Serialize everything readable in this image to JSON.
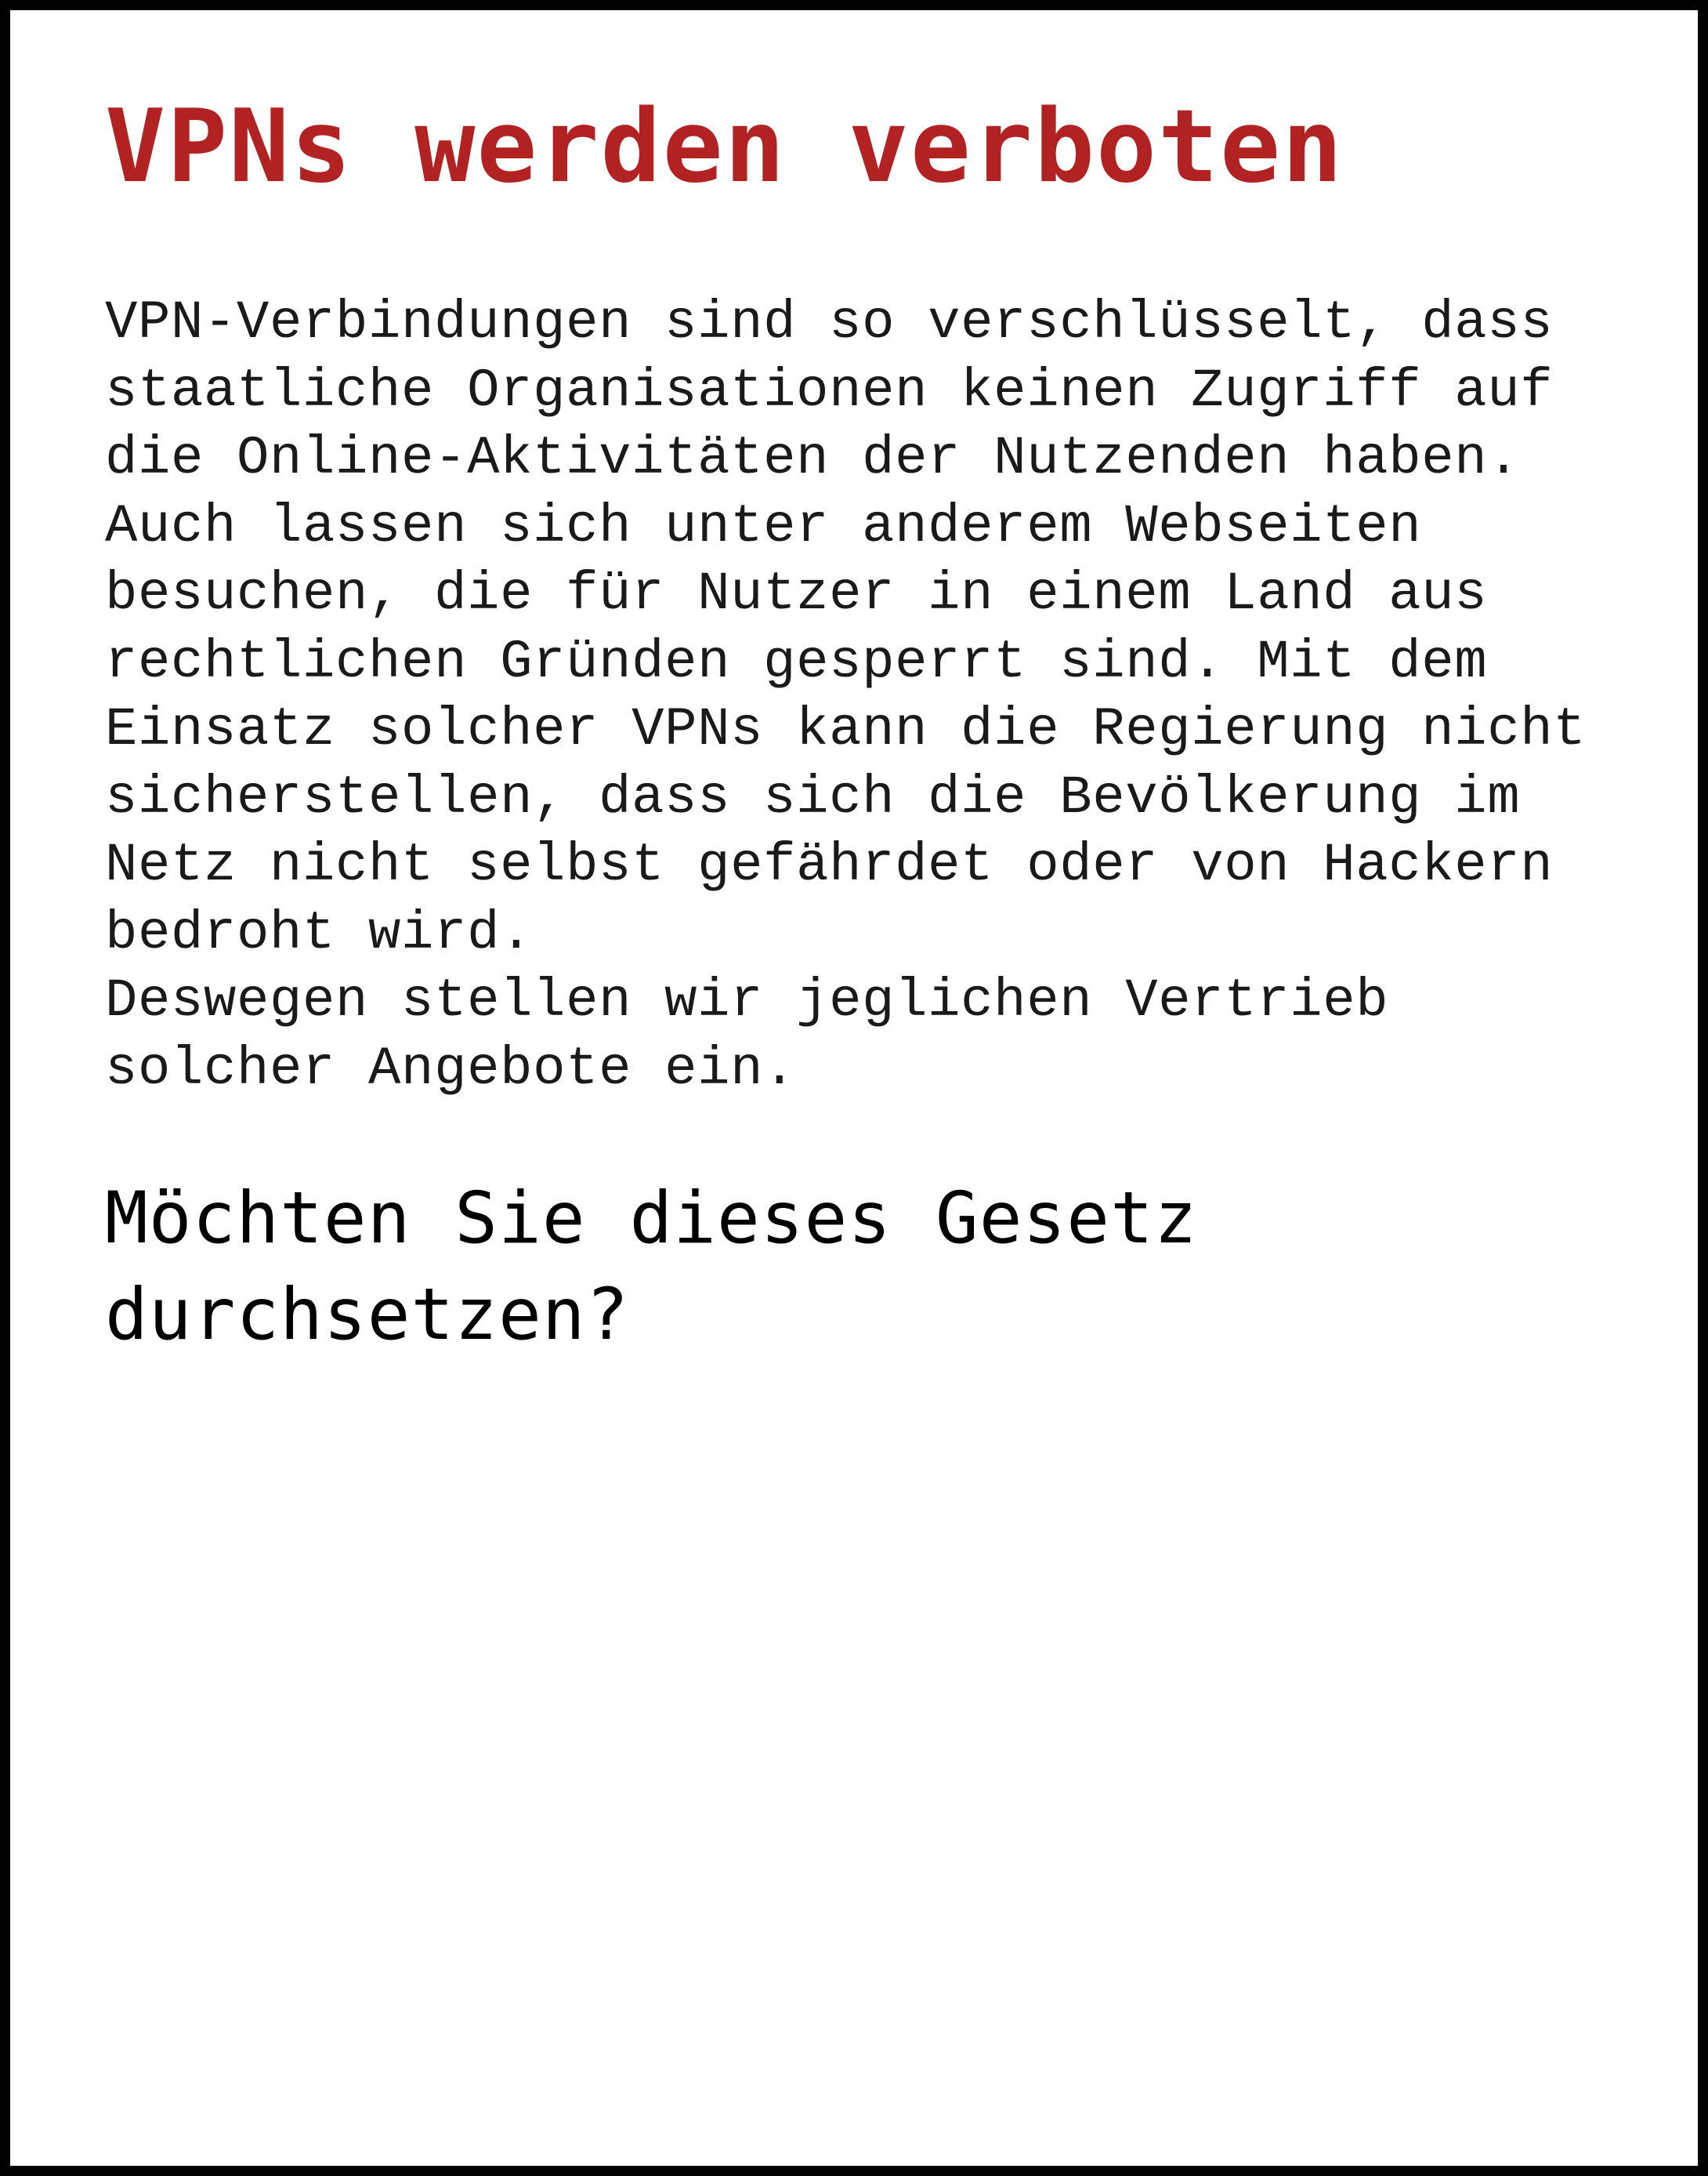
{
  "title": "VPNs werden verboten",
  "body": "VPN-Verbindungen sind so verschlüsselt, dass\nstaatliche Organisationen keinen Zugriff auf\ndie Online-Aktivitäten der Nutzenden haben.\nAuch lassen sich unter anderem Webseiten\nbesuchen, die für Nutzer in einem Land aus\nrechtlichen Gründen gesperrt sind. Mit dem\nEinsatz solcher VPNs kann die Regierung nicht\nsicherstellen, dass sich die Bevölkerung im\nNetz nicht selbst gefährdet oder von Hackern\nbedroht wird.\nDeswegen stellen wir jeglichen Vertrieb\nsolcher Angebote ein.",
  "question": "Möchten Sie dieses Gesetz\ndurchsetzen?",
  "colors": {
    "title": "#b22222",
    "frame": "#000000",
    "background": "#ffffff",
    "text": "#1a1a1a"
  }
}
